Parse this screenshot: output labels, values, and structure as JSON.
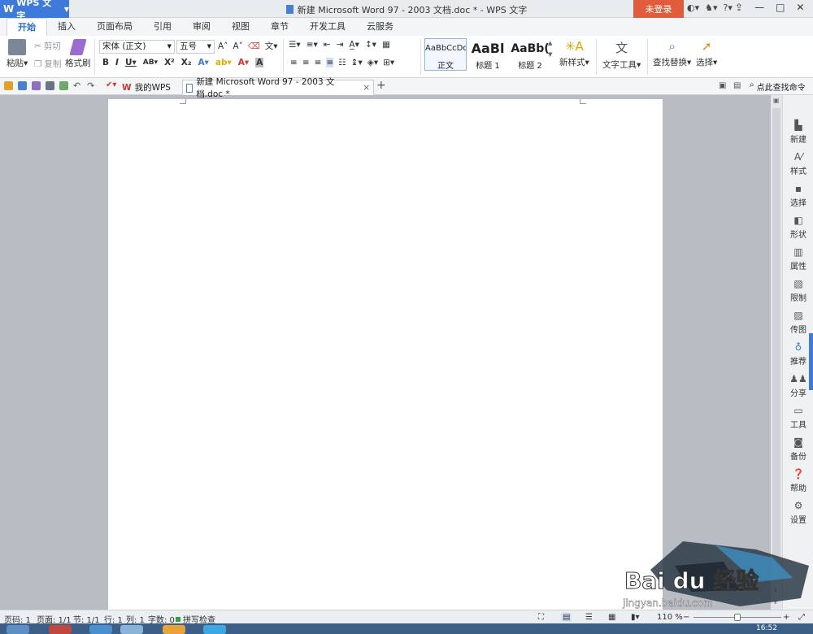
{
  "app": {
    "name": "WPS 文字",
    "window_title": "新建 Microsoft Word 97 - 2003 文档.doc * - WPS 文字",
    "login_label": "未登录"
  },
  "menu_tabs": [
    "开始",
    "插入",
    "页面布局",
    "引用",
    "审阅",
    "视图",
    "章节",
    "开发工具",
    "云服务"
  ],
  "clipboard": {
    "paste": "粘贴",
    "cut": "剪切",
    "copy": "复制",
    "format_painter": "格式刷"
  },
  "font": {
    "name": "宋体 (正文)",
    "size": "五号"
  },
  "styles": [
    {
      "preview": "AaBbCcDd",
      "label": "正文"
    },
    {
      "preview": "AaBl",
      "label": "标题 1"
    },
    {
      "preview": "AaBb(",
      "label": "标题 2"
    }
  ],
  "ribbon_labels": {
    "new_style": "新样式",
    "text_tools": "文字工具",
    "find_replace": "查找替换",
    "select": "选择"
  },
  "doc_tabs": [
    {
      "label": "我的WPS"
    },
    {
      "label": "新建 Microsoft Word 97 - 2003 文档.doc *"
    }
  ],
  "search_command": "点此查找命令",
  "side_panel": [
    "新建",
    "样式",
    "选择",
    "形状",
    "属性",
    "限制",
    "传图",
    "推荐",
    "分享",
    "工具",
    "备份",
    "帮助",
    "设置"
  ],
  "status": {
    "page": "页码: 1",
    "pages": "页面: 1/1",
    "section": "节: 1/1",
    "row": "行: 1",
    "col": "列: 1",
    "words": "字数: 0",
    "spell": "拼写检查",
    "zoom": "110 %",
    "time": "16:52"
  },
  "watermark": {
    "text": "Bai du 经验",
    "url": "jingyan.baidu.com"
  },
  "colors": {
    "accent": "#3d7ad9",
    "login": "#e05c3c",
    "wps_red": "#d9342b"
  }
}
